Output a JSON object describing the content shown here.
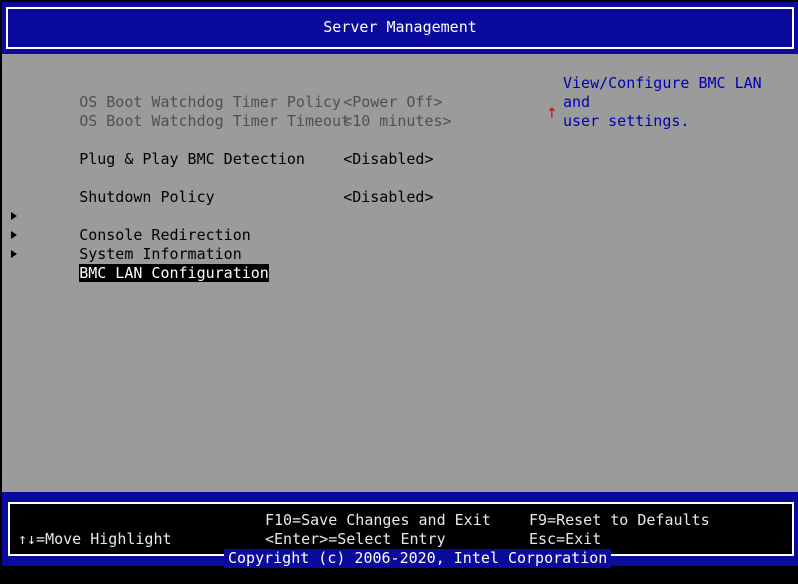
{
  "header": {
    "title": "Server Management"
  },
  "colors": {
    "header_blue": "#0a0a9c",
    "body_gray": "#9b9b9b",
    "help_text": "#0000b0",
    "scroll_indicator": "#d40000"
  },
  "menu": {
    "items": [
      {
        "label": "OS Boot Watchdog Timer Policy",
        "value": "<Power Off>",
        "enabled": false
      },
      {
        "label": "OS Boot Watchdog Timer Timeout",
        "value": "<10 minutes>",
        "enabled": false
      },
      {
        "label": "Plug & Play BMC Detection",
        "value": "<Disabled>",
        "enabled": true
      },
      {
        "label": "Shutdown Policy",
        "value": "<Disabled>",
        "enabled": true
      },
      {
        "label": "Console Redirection",
        "submenu": true
      },
      {
        "label": "System Information",
        "submenu": true
      },
      {
        "label": "BMC LAN Configuration",
        "submenu": true,
        "selected": true
      }
    ]
  },
  "scroll_indicator": "↑",
  "help": {
    "text": "View/Configure BMC LAN and\nuser settings."
  },
  "footer": {
    "move_highlight": "↑↓=Move Highlight",
    "save_exit": "F10=Save Changes and Exit",
    "select_entry": "<Enter>=Select Entry",
    "reset_defaults": "F9=Reset to Defaults",
    "esc_exit": "Esc=Exit",
    "copyright": "Copyright (c) 2006-2020, Intel Corporation"
  }
}
